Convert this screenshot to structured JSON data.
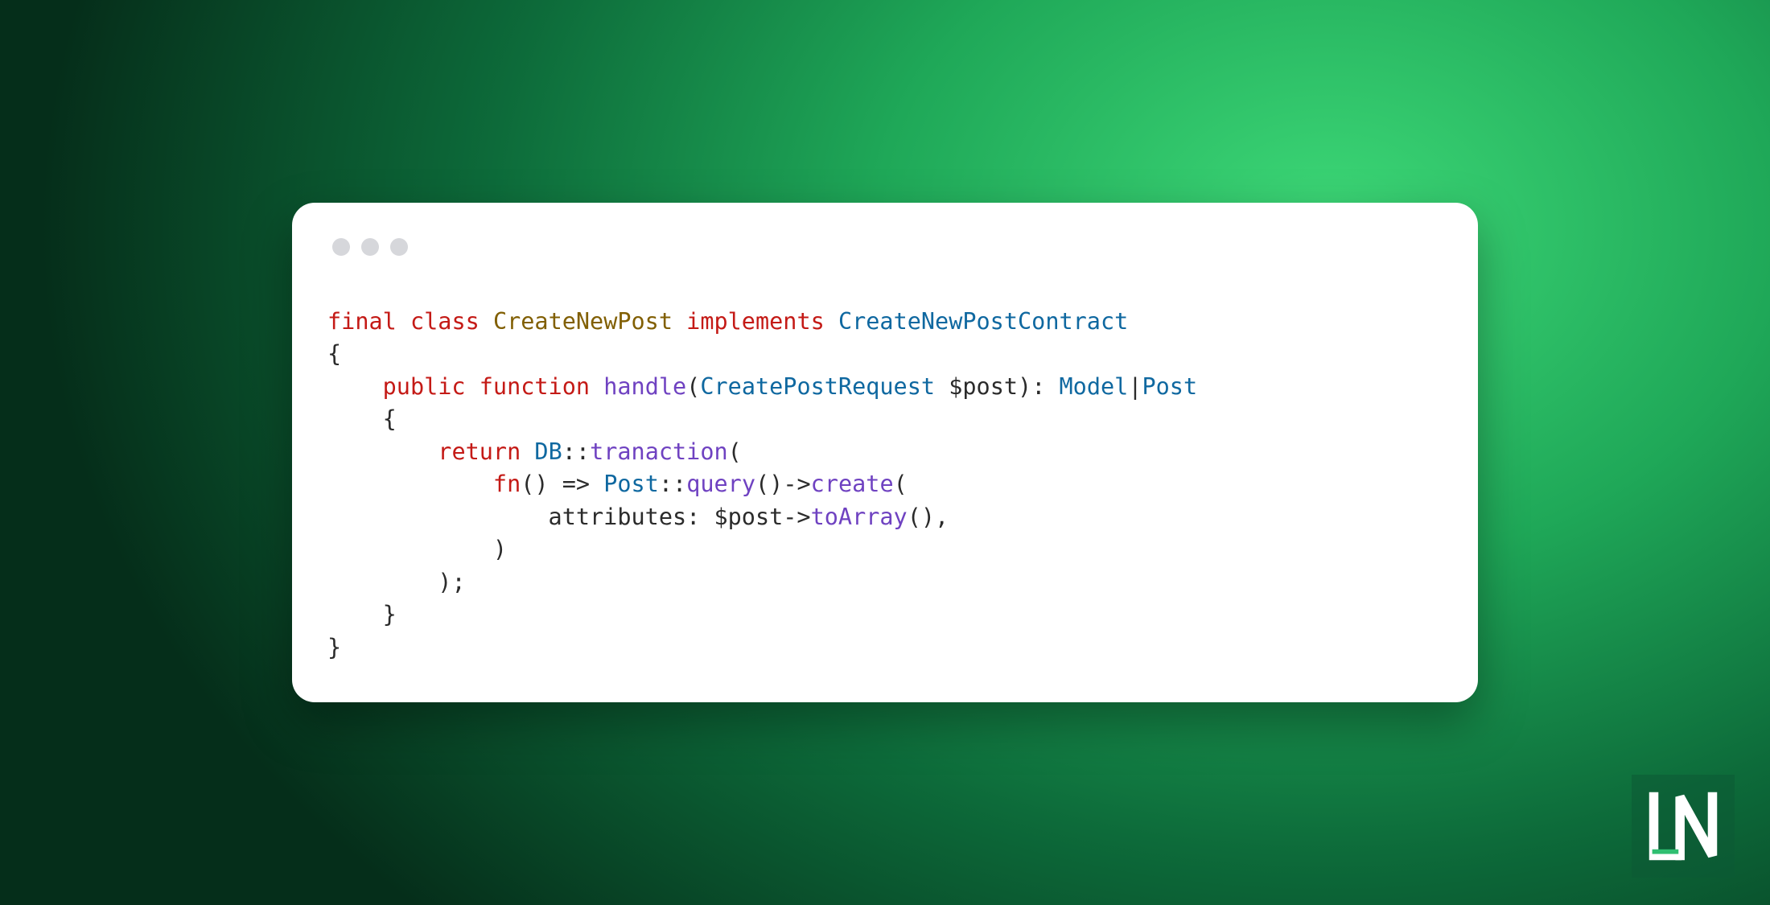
{
  "code": {
    "tokens": {
      "final": "final",
      "class": "class",
      "className": "CreateNewPost",
      "implements": "implements",
      "contract": "CreateNewPostContract",
      "public": "public",
      "function": "function",
      "method": "handle",
      "paramType": "CreatePostRequest",
      "paramVar": "$post",
      "retModel": "Model",
      "retPost": "Post",
      "return": "return",
      "db": "DB",
      "tranaction": "tranaction",
      "fn": "fn",
      "arrow": "=>",
      "postClass": "Post",
      "query": "query",
      "create": "create",
      "attributes": "attributes",
      "postVar": "$post",
      "toArray": "toArray"
    },
    "punct": {
      "openBrace": "{",
      "closeBrace": "}",
      "openParen": "(",
      "closeParen": ")",
      "closeParenSemi": ");",
      "colonSp": ": ",
      "pipe": "|",
      "dblColon": "::",
      "thinArrow": "->",
      "comma": ",",
      "emptyParens": "()"
    }
  },
  "logo": {
    "letters": "LN"
  }
}
